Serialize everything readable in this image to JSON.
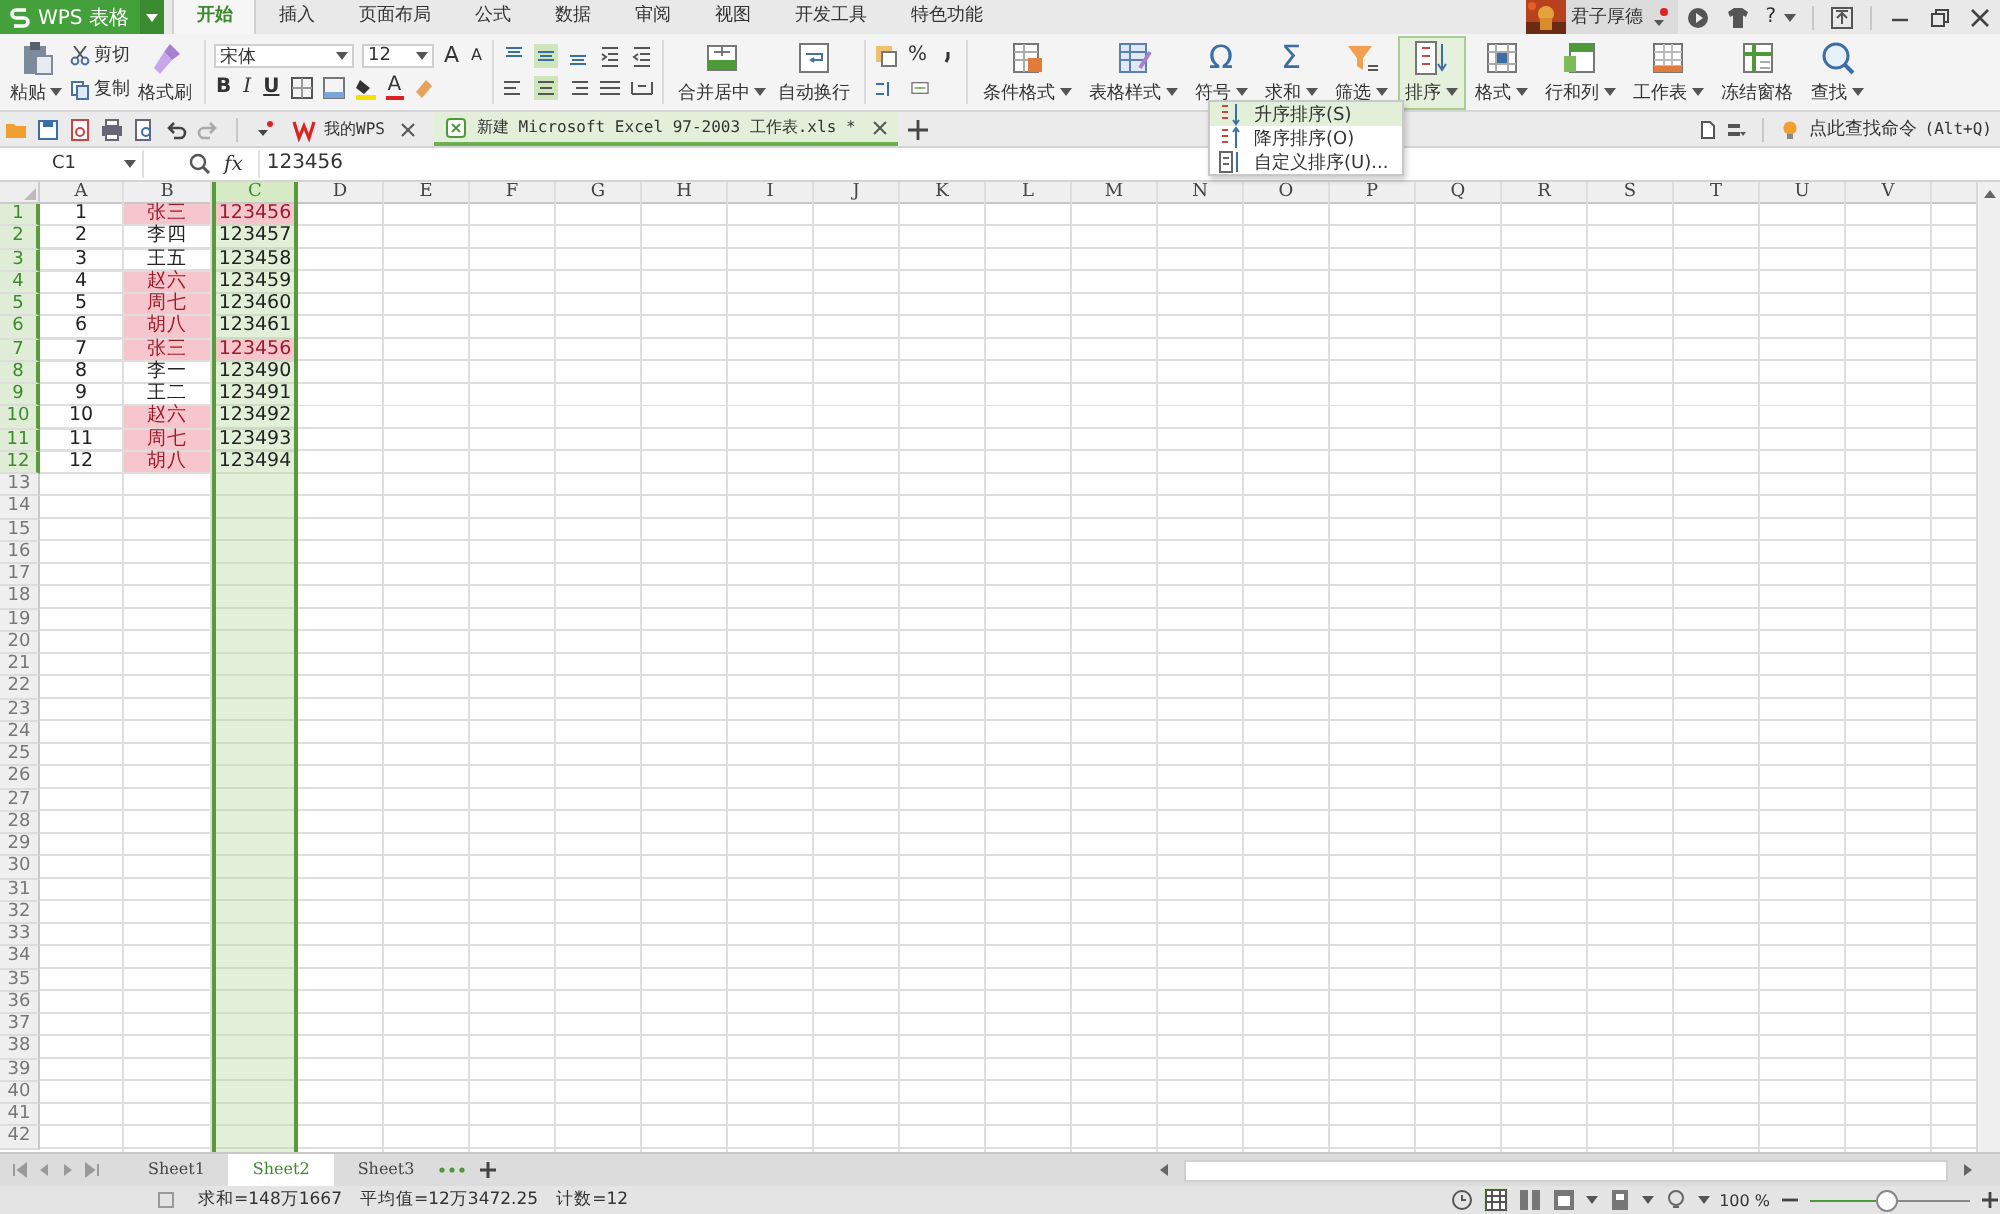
{
  "app": {
    "logo": "WPS 表格"
  },
  "menu_tabs": [
    {
      "label": "开始",
      "selected": true
    },
    {
      "label": "插入",
      "selected": false
    },
    {
      "label": "页面布局",
      "selected": false
    },
    {
      "label": "公式",
      "selected": false
    },
    {
      "label": "数据",
      "selected": false
    },
    {
      "label": "审阅",
      "selected": false
    },
    {
      "label": "视图",
      "selected": false
    },
    {
      "label": "开发工具",
      "selected": false
    },
    {
      "label": "特色功能",
      "selected": false
    }
  ],
  "user": {
    "name": "君子厚德",
    "help": "?"
  },
  "ribbon": {
    "paste": "粘贴",
    "cut": "剪切",
    "copy": "复制",
    "painter": "格式刷",
    "font_name": "宋体",
    "font_size": "12",
    "grow": "A",
    "shrink": "A",
    "styles": [
      "B",
      "I",
      "U"
    ],
    "font_color": "A",
    "align_top": [
      {
        "selected": false
      },
      {
        "selected": true
      },
      {
        "selected": false
      }
    ],
    "align_bottom": [
      {
        "selected": false
      },
      {
        "selected": true
      },
      {
        "selected": false
      }
    ],
    "merge": "合并居中",
    "wrap": "自动换行",
    "percent": "%",
    "tools": [
      {
        "kind": "conditional",
        "label": "条件格式",
        "dropdown": true,
        "selected": false
      },
      {
        "kind": "style",
        "label": "表格样式",
        "dropdown": true,
        "selected": false
      },
      {
        "kind": "glyph",
        "glyph": "Ω",
        "label": "符号",
        "dropdown": true,
        "selected": false
      },
      {
        "kind": "glyph",
        "glyph": "Σ",
        "label": "求和",
        "dropdown": true,
        "selected": false
      },
      {
        "kind": "funnel",
        "label": "筛选",
        "dropdown": true,
        "selected": false
      },
      {
        "kind": "sort",
        "label": "排序",
        "dropdown": true,
        "selected": true
      },
      {
        "kind": "format",
        "label": "格式",
        "dropdown": true,
        "selected": false
      },
      {
        "kind": "rowcol",
        "label": "行和列",
        "dropdown": true,
        "selected": false
      },
      {
        "kind": "sheet",
        "label": "工作表",
        "dropdown": true,
        "selected": false
      },
      {
        "kind": "freeze",
        "label": "冻结窗格",
        "dropdown": false,
        "selected": false
      },
      {
        "kind": "find",
        "label": "查找",
        "dropdown": true,
        "selected": false
      }
    ]
  },
  "search_command": {
    "label": "点此查找命令",
    "shortcut": "(Alt+Q)"
  },
  "sort_menu": [
    {
      "kind": "asc",
      "label": "升序排序(S)",
      "selected": true
    },
    {
      "kind": "desc",
      "label": "降序排序(O)",
      "selected": false
    },
    {
      "kind": "custom",
      "label": "自定义排序(U)...",
      "selected": false
    }
  ],
  "doc_tabs": [
    {
      "label": "我的WPS",
      "selected": false
    },
    {
      "label": "新建 Microsoft Excel 97-2003 工作表.xls *",
      "selected": true
    }
  ],
  "formula_bar": {
    "cell": "C1",
    "fx": "fx",
    "value": "123456"
  },
  "sheet": {
    "columns": [
      {
        "label": "A",
        "selected": false
      },
      {
        "label": "B",
        "selected": false
      },
      {
        "label": "C",
        "selected": true
      },
      {
        "label": "D",
        "selected": false
      },
      {
        "label": "E",
        "selected": false
      },
      {
        "label": "F",
        "selected": false
      },
      {
        "label": "G",
        "selected": false
      },
      {
        "label": "H",
        "selected": false
      },
      {
        "label": "I",
        "selected": false
      },
      {
        "label": "J",
        "selected": false
      },
      {
        "label": "K",
        "selected": false
      },
      {
        "label": "L",
        "selected": false
      },
      {
        "label": "M",
        "selected": false
      },
      {
        "label": "N",
        "selected": false
      },
      {
        "label": "O",
        "selected": false
      },
      {
        "label": "P",
        "selected": false
      },
      {
        "label": "Q",
        "selected": false
      },
      {
        "label": "R",
        "selected": false
      },
      {
        "label": "S",
        "selected": false
      },
      {
        "label": "T",
        "selected": false
      },
      {
        "label": "U",
        "selected": false
      },
      {
        "label": "V",
        "selected": false
      }
    ],
    "rows": [
      {
        "label": "1",
        "highlighted": true,
        "cells": [
          {
            "value": "1",
            "duplicate": false
          },
          {
            "value": "张三",
            "duplicate": true
          },
          {
            "value": "123456",
            "duplicate": true
          }
        ]
      },
      {
        "label": "2",
        "highlighted": true,
        "cells": [
          {
            "value": "2",
            "duplicate": false
          },
          {
            "value": "李四",
            "duplicate": false
          },
          {
            "value": "123457",
            "duplicate": false
          }
        ]
      },
      {
        "label": "3",
        "highlighted": true,
        "cells": [
          {
            "value": "3",
            "duplicate": false
          },
          {
            "value": "王五",
            "duplicate": false
          },
          {
            "value": "123458",
            "duplicate": false
          }
        ]
      },
      {
        "label": "4",
        "highlighted": true,
        "cells": [
          {
            "value": "4",
            "duplicate": false
          },
          {
            "value": "赵六",
            "duplicate": true
          },
          {
            "value": "123459",
            "duplicate": false
          }
        ]
      },
      {
        "label": "5",
        "highlighted": true,
        "cells": [
          {
            "value": "5",
            "duplicate": false
          },
          {
            "value": "周七",
            "duplicate": true
          },
          {
            "value": "123460",
            "duplicate": false
          }
        ]
      },
      {
        "label": "6",
        "highlighted": true,
        "cells": [
          {
            "value": "6",
            "duplicate": false
          },
          {
            "value": "胡八",
            "duplicate": true
          },
          {
            "value": "123461",
            "duplicate": false
          }
        ]
      },
      {
        "label": "7",
        "highlighted": true,
        "cells": [
          {
            "value": "7",
            "duplicate": false
          },
          {
            "value": "张三",
            "duplicate": true
          },
          {
            "value": "123456",
            "duplicate": true
          }
        ]
      },
      {
        "label": "8",
        "highlighted": true,
        "cells": [
          {
            "value": "8",
            "duplicate": false
          },
          {
            "value": "李一",
            "duplicate": false
          },
          {
            "value": "123490",
            "duplicate": false
          }
        ]
      },
      {
        "label": "9",
        "highlighted": true,
        "cells": [
          {
            "value": "9",
            "duplicate": false
          },
          {
            "value": "王二",
            "duplicate": false
          },
          {
            "value": "123491",
            "duplicate": false
          }
        ]
      },
      {
        "label": "10",
        "highlighted": true,
        "cells": [
          {
            "value": "10",
            "duplicate": false
          },
          {
            "value": "赵六",
            "duplicate": true
          },
          {
            "value": "123492",
            "duplicate": false
          }
        ]
      },
      {
        "label": "11",
        "highlighted": true,
        "cells": [
          {
            "value": "11",
            "duplicate": false
          },
          {
            "value": "周七",
            "duplicate": true
          },
          {
            "value": "123493",
            "duplicate": false
          }
        ]
      },
      {
        "label": "12",
        "highlighted": true,
        "cells": [
          {
            "value": "12",
            "duplicate": false
          },
          {
            "value": "胡八",
            "duplicate": true
          },
          {
            "value": "123494",
            "duplicate": false
          }
        ]
      },
      {
        "label": "13",
        "highlighted": false
      },
      {
        "label": "14",
        "highlighted": false
      },
      {
        "label": "15",
        "highlighted": false
      },
      {
        "label": "16",
        "highlighted": false
      },
      {
        "label": "17",
        "highlighted": false
      },
      {
        "label": "18",
        "highlighted": false
      },
      {
        "label": "19",
        "highlighted": false
      },
      {
        "label": "20",
        "highlighted": false
      },
      {
        "label": "21",
        "highlighted": false
      },
      {
        "label": "22",
        "highlighted": false
      },
      {
        "label": "23",
        "highlighted": false
      },
      {
        "label": "24",
        "highlighted": false
      },
      {
        "label": "25",
        "highlighted": false
      },
      {
        "label": "26",
        "highlighted": false
      },
      {
        "label": "27",
        "highlighted": false
      },
      {
        "label": "28",
        "highlighted": false
      },
      {
        "label": "29",
        "highlighted": false
      },
      {
        "label": "30",
        "highlighted": false
      },
      {
        "label": "31",
        "highlighted": false
      },
      {
        "label": "32",
        "highlighted": false
      },
      {
        "label": "33",
        "highlighted": false
      },
      {
        "label": "34",
        "highlighted": false
      },
      {
        "label": "35",
        "highlighted": false
      },
      {
        "label": "36",
        "highlighted": false
      },
      {
        "label": "37",
        "highlighted": false
      },
      {
        "label": "38",
        "highlighted": false
      },
      {
        "label": "39",
        "highlighted": false
      },
      {
        "label": "40",
        "highlighted": false
      },
      {
        "label": "41",
        "highlighted": false
      },
      {
        "label": "42",
        "highlighted": false
      }
    ]
  },
  "sheet_tabs": [
    {
      "label": "Sheet1",
      "selected": false
    },
    {
      "label": "Sheet2",
      "selected": true
    },
    {
      "label": "Sheet3",
      "selected": false
    }
  ],
  "status": {
    "stats": [
      "求和=148万1667",
      "平均值=12万3472.25",
      "计数=12"
    ],
    "zoom": {
      "label": "100 %",
      "level": 0.48
    }
  }
}
